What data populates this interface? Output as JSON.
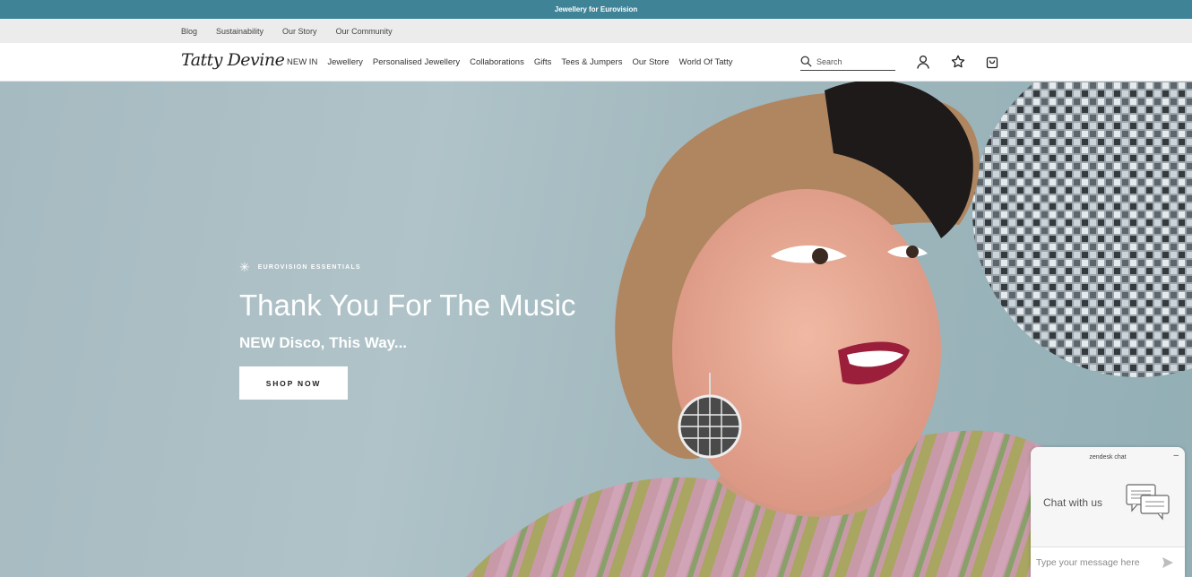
{
  "announcement": "Jewellery for Eurovision",
  "utility_nav": [
    "Blog",
    "Sustainability",
    "Our Story",
    "Our Community"
  ],
  "logo": "Tatty Devine",
  "main_nav": [
    "NEW IN",
    "Jewellery",
    "Personalised Jewellery",
    "Collaborations",
    "Gifts",
    "Tees & Jumpers",
    "Our Store",
    "World Of Tatty"
  ],
  "search": {
    "placeholder": "Search",
    "icon": "search-icon"
  },
  "header_icons": [
    "account-icon",
    "wishlist-star-icon",
    "shopping-bag-icon"
  ],
  "hero": {
    "eyebrow": "EUROVISION ESSENTIALS",
    "eyebrow_icon": "asterisk-icon",
    "headline": "Thank You For The Music",
    "subline": "NEW Disco, This Way...",
    "cta": "SHOP NOW"
  },
  "chat": {
    "header": "zendesk chat",
    "minimize": "–",
    "prompt": "Chat with us",
    "input_placeholder": "Type your message here"
  },
  "colors": {
    "announce_bar": "#3f8397",
    "utility_bar": "#ececec",
    "hero_bg": "#a6bac1"
  }
}
